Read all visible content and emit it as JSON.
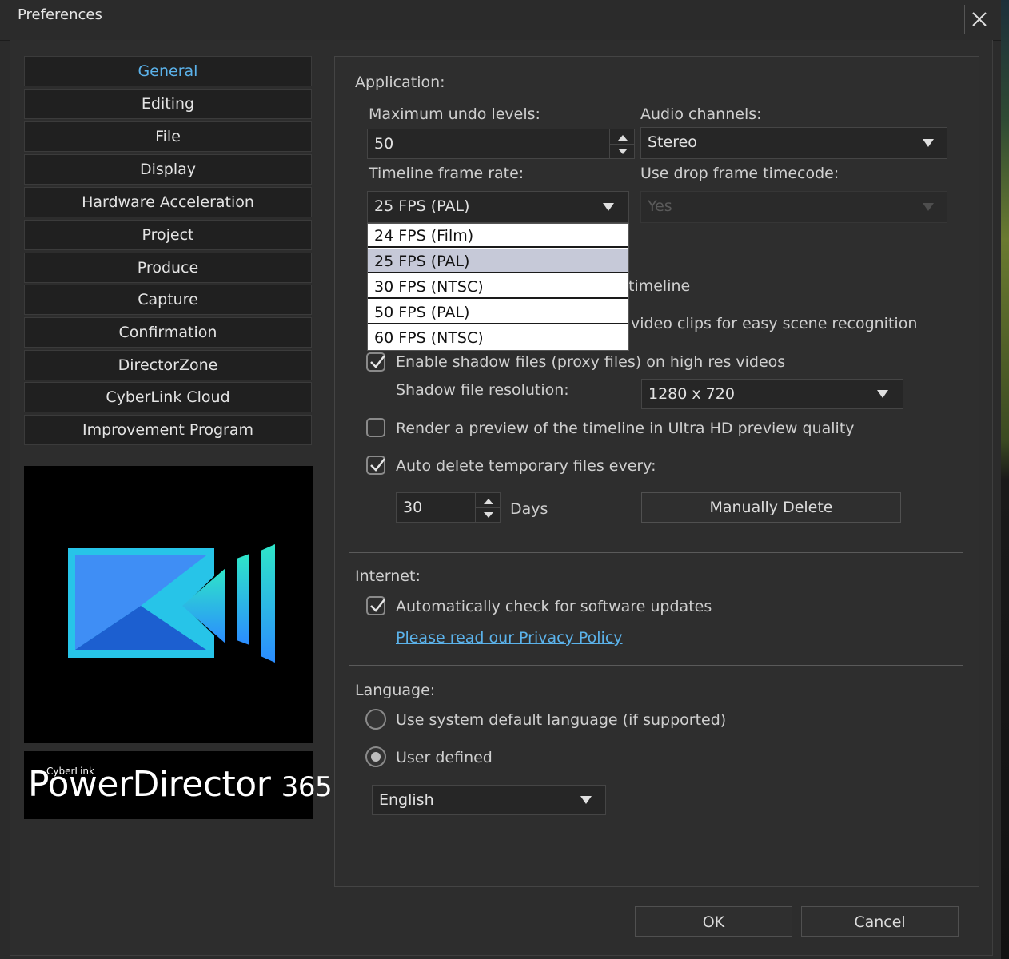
{
  "window": {
    "title": "Preferences"
  },
  "sidebar": {
    "items": [
      {
        "label": "General"
      },
      {
        "label": "Editing"
      },
      {
        "label": "File"
      },
      {
        "label": "Display"
      },
      {
        "label": "Hardware Acceleration"
      },
      {
        "label": "Project"
      },
      {
        "label": "Produce"
      },
      {
        "label": "Capture"
      },
      {
        "label": "Confirmation"
      },
      {
        "label": "DirectorZone"
      },
      {
        "label": "CyberLink Cloud"
      },
      {
        "label": "Improvement Program"
      }
    ],
    "active_index": 0
  },
  "brand": {
    "small": "CyberLink",
    "name": "PowerDirector",
    "version": "365"
  },
  "application": {
    "section_label": "Application:",
    "undo_label": "Maximum undo levels:",
    "undo_value": "50",
    "audio_label": "Audio channels:",
    "audio_value": "Stereo",
    "framerate_label": "Timeline frame rate:",
    "framerate_value": "25 FPS (PAL)",
    "dropframe_label": "Use drop frame timecode:",
    "dropframe_value": "Yes",
    "framerate_options": [
      "24 FPS (Film)",
      "25 FPS (PAL)",
      "30 FPS (NTSC)",
      "50 FPS (PAL)",
      "60 FPS (NTSC)"
    ],
    "framerate_selected_index": 1,
    "obscured_option1_tail": "timeline",
    "obscured_option2_tail": "video clips for easy scene recognition",
    "shadow_label": "Enable shadow files (proxy files) on high res videos",
    "shadow_checked": true,
    "shadow_res_label": "Shadow file resolution:",
    "shadow_res_value": "1280 x 720",
    "render_preview_label": "Render a preview of the timeline in Ultra HD preview quality",
    "render_preview_checked": false,
    "auto_delete_label": "Auto delete temporary files every:",
    "auto_delete_checked": true,
    "days_value": "30",
    "days_label": "Days",
    "manual_delete_label": "Manually Delete"
  },
  "internet": {
    "section_label": "Internet:",
    "auto_check_label": "Automatically check for software updates",
    "auto_check_checked": true,
    "privacy_link": "Please read our Privacy Policy"
  },
  "language": {
    "section_label": "Language:",
    "system_default_label": "Use system default language (if supported)",
    "user_defined_label": "User defined",
    "selected": "user_defined",
    "language_value": "English"
  },
  "footer": {
    "ok_label": "OK",
    "cancel_label": "Cancel"
  },
  "colors": {
    "accent": "#5bb2ea",
    "background": "#2b2b2b",
    "panel": "#2e2e2e",
    "nav_item": "#202020"
  }
}
